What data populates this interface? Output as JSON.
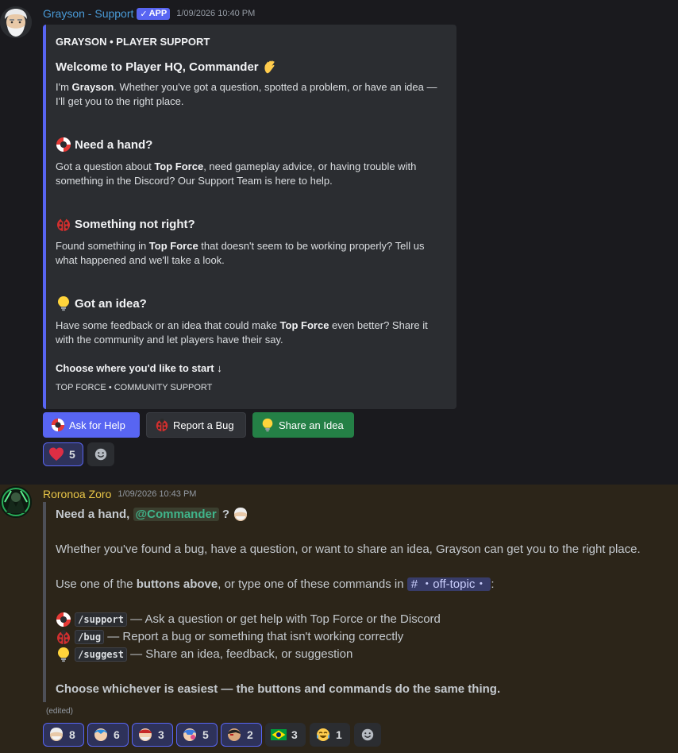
{
  "message1": {
    "username": "Grayson - Support",
    "badge": "APP",
    "timestamp": "1/09/2026 10:40 PM",
    "embed": {
      "author": "GRAYSON • PLAYER SUPPORT",
      "title": "Welcome to Player HQ, Commander",
      "intro_pre": "I'm ",
      "intro_bold": "Grayson",
      "intro_post": ". Whether you've got a question, spotted a problem, or have an idea — I'll get you to the right place.",
      "sections": [
        {
          "title": "Need a hand?",
          "icon": "lifebuoy-icon",
          "pre": "Got a question about ",
          "bold": "Top Force",
          "post": ", need gameplay advice, or having trouble with something in the Discord? Our Support Team is here to help."
        },
        {
          "title": "Something not right?",
          "icon": "ladybug-icon",
          "pre": "Found something in ",
          "bold": "Top Force",
          "post": " that doesn't seem to be working properly? Tell us what happened and we'll take a look."
        },
        {
          "title": "Got an idea?",
          "icon": "lightbulb-icon",
          "pre": "Have some feedback or an idea that could make ",
          "bold": "Top Force",
          "post": " even better? Share it with the community and let players have their say."
        }
      ],
      "cta": "Choose where you'd like to start ↓",
      "footer": "TOP FORCE • COMMUNITY SUPPORT"
    },
    "buttons": [
      {
        "label": "Ask for Help",
        "icon": "lifebuoy-icon"
      },
      {
        "label": "Report a Bug",
        "icon": "ladybug-icon"
      },
      {
        "label": "Share an Idea",
        "icon": "lightbulb-icon"
      }
    ],
    "reactions": [
      {
        "emoji": "heart-icon",
        "count": "5"
      }
    ]
  },
  "message2": {
    "username": "Roronoa Zoro",
    "timestamp": "1/09/2026 10:43 PM",
    "heading_pre": "Need a hand, ",
    "mention": "@Commander",
    "heading_post": " ?",
    "line1": "Whether you've found a bug, have a question, or want to share an idea, Grayson can get you to the right place.",
    "line2_pre": "Use one of the ",
    "line2_bold": "buttons above",
    "line2_post": ", or type one of these commands in",
    "channel": "# ・off-topic・",
    "line2_end": ":",
    "commands": [
      {
        "icon": "lifebuoy-icon",
        "cmd": "/support",
        "desc": "— Ask a question or get help with Top Force or the Discord"
      },
      {
        "icon": "ladybug-icon",
        "cmd": "/bug",
        "desc": "— Report a bug or something that isn't working correctly"
      },
      {
        "icon": "lightbulb-icon",
        "cmd": "/suggest",
        "desc": "— Share an idea, feedback, or suggestion"
      }
    ],
    "closing": "Choose whichever is easiest — the buttons and commands do the same thing.",
    "edited": "(edited)",
    "reactions": [
      {
        "emoji": "grayson-emote-icon",
        "count": "8"
      },
      {
        "emoji": "blue-character-emote-icon",
        "count": "6"
      },
      {
        "emoji": "red-character-emote-icon",
        "count": "3"
      },
      {
        "emoji": "pink-character-emote-icon",
        "count": "5"
      },
      {
        "emoji": "dark-character-emote-icon",
        "count": "2"
      },
      {
        "emoji": "brazil-flag-icon",
        "count": "3"
      },
      {
        "emoji": "joy-face-icon",
        "count": "1"
      }
    ]
  },
  "colors": {
    "accent": "#5865f2",
    "success": "#248046",
    "bot_name": "#4a9bd8",
    "zoro_name": "#e8c547"
  }
}
